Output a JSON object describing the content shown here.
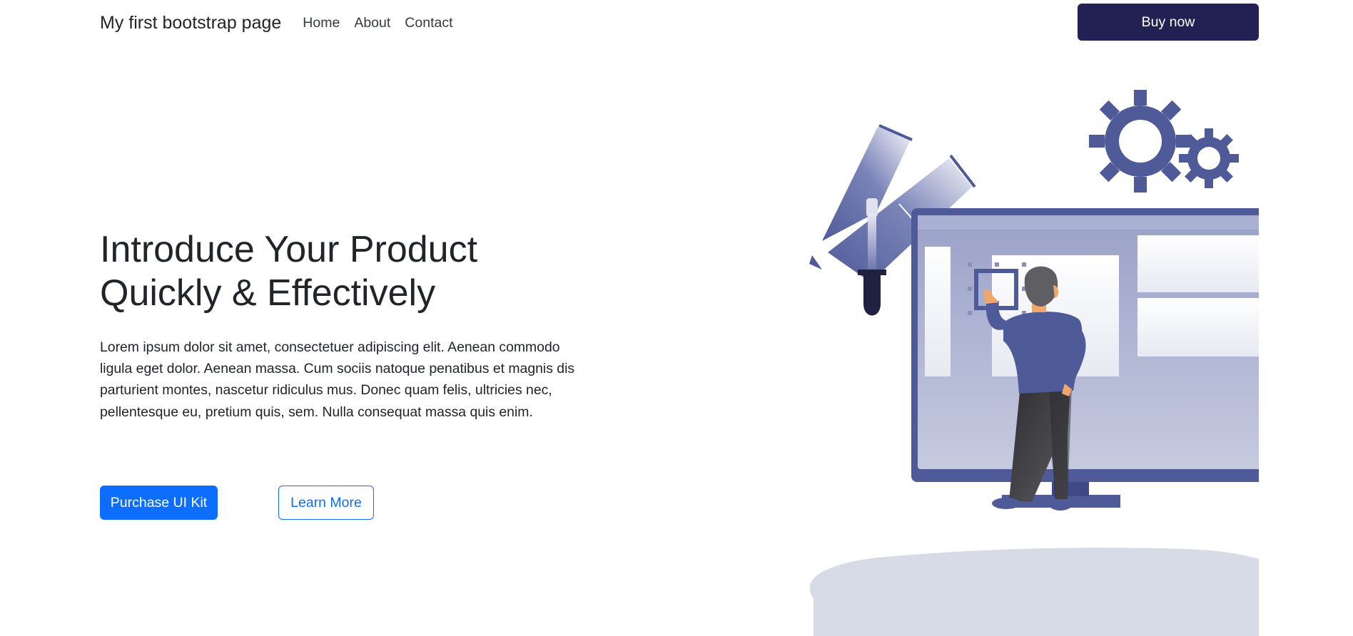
{
  "navbar": {
    "brand": "My first bootstrap page",
    "links": [
      "Home",
      "About",
      "Contact"
    ],
    "cta": "Buy now"
  },
  "hero": {
    "title": "Introduce Your Product Quickly & Effectively",
    "text": "Lorem ipsum dolor sit amet, consectetuer adipiscing elit. Aenean commodo ligula eget dolor. Aenean massa. Cum sociis natoque penatibus et magnis dis parturient montes, nascetur ridiculus mus. Donec quam felis, ultricies nec, pellentesque eu, pretium quis, sem. Nulla consequat massa quis enim.",
    "primary_button": "Purchase UI Kit",
    "secondary_button": "Learn More"
  },
  "colors": {
    "navy": "#232153",
    "primary": "#0d6efd",
    "illustration": "#4f5b99",
    "ground": "#d7dae7"
  },
  "illustration": {
    "icons": [
      "gear-icon",
      "paint-tube-icon",
      "dropper-icon",
      "monitor-icon",
      "person-figure"
    ]
  }
}
